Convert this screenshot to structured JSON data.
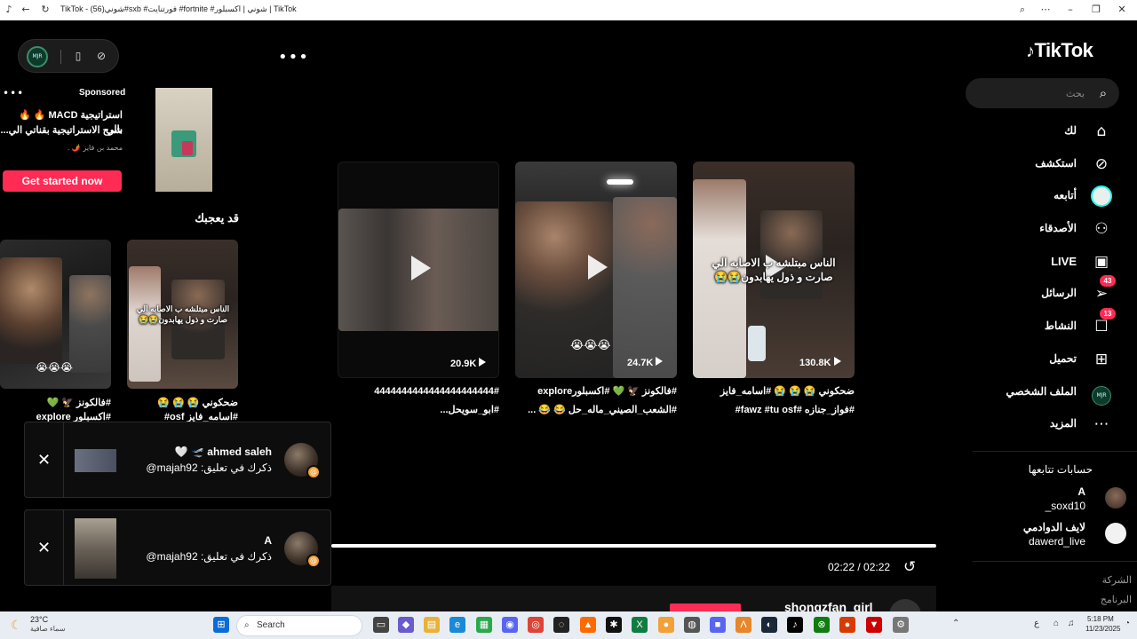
{
  "browser": {
    "title": "TikTok - شوني(56)#sxb #فورتنايت #fortnite #شوني | اكسبلور | TikTok"
  },
  "mini_toolbar": {
    "avatar_text": "MJR"
  },
  "sponsored": {
    "label": "Sponsored",
    "title_line1": "استراتيجية MACD 🔥 🔥 بالي",
    "title_line2": "شرح الاستراتيجية بقناتي الي...",
    "author": "محمد بن فايز 🌶️ .",
    "cta": "Get started now"
  },
  "suggest_head": "قد يعجبك",
  "suggested": [
    {
      "caption1": "#فالكونز 🦅 💚",
      "caption2": "#اكسبلور explore"
    },
    {
      "overlay": "الناس مبتلشه ب الاصابه الي صارت و ذول يهابدون😭😭",
      "caption1": "ضحكوني 😭 😭 😭",
      "caption2": "#اسامه_فايز osf#"
    }
  ],
  "videos": [
    {
      "views": "20.9K",
      "caption1": "4444444444444444444444#",
      "caption2": "#ابو_سويحل..."
    },
    {
      "views": "24.7K",
      "overlay": "😭😭😭",
      "caption1": "#فالكونز 🦅 💚 #اكسبلورexplore",
      "caption2": "#الشعب_الصيني_ماله_حل 😂 😂 ..."
    },
    {
      "views": "130.8K",
      "overlay": "الناس مبتلشه ب الاصابه الي صارت و ذول يهابدون😭😭",
      "caption1": "ضحكوني 😭 😭 😭 #اسامه_فايز",
      "caption2": "#فواز_جنازه #fawz #tu osf#"
    }
  ],
  "notifications": [
    {
      "name": "ahmed saleh 🛫 🤍",
      "text": "ذكرك في تعليق: majah92@"
    },
    {
      "name": "A",
      "text": "ذكرك في تعليق: majah92@"
    }
  ],
  "player": {
    "time": "02:22 / 02:22",
    "progress": 1.0
  },
  "sidebar": {
    "logo": "TikTok",
    "search_placeholder": "بحث",
    "nav": [
      {
        "label": "لك",
        "icon": "home-icon"
      },
      {
        "label": "استكشف",
        "icon": "compass-icon"
      },
      {
        "label": "أتابعه",
        "icon": "following-avatar-icon"
      },
      {
        "label": "الأصدقاء",
        "icon": "friends-icon"
      },
      {
        "label": "LIVE",
        "icon": "live-icon"
      },
      {
        "label": "الرسائل",
        "icon": "messages-icon",
        "badge": "43"
      },
      {
        "label": "النشاط",
        "icon": "activity-icon",
        "badge": "13"
      },
      {
        "label": "تحميل",
        "icon": "upload-icon"
      },
      {
        "label": "الملف الشخصي",
        "icon": "profile-avatar-icon"
      },
      {
        "label": "المزيد",
        "icon": "more-icon"
      }
    ],
    "following_head": "حسابات تتابعها",
    "following": [
      {
        "name": "A",
        "handle": "_soxd10"
      },
      {
        "name": "لايف الدوادمي",
        "handle": "dawerd_live"
      }
    ],
    "footer": [
      "الشركة",
      "البرنامج"
    ]
  },
  "bottom_peek": {
    "user": "shongzfan_girl"
  },
  "taskbar": {
    "weather_temp": "23°C",
    "weather_desc": "سماء صافية",
    "search_label": "Search",
    "time": "5:18 PM",
    "date": "11/23/2025",
    "lang": "ع"
  },
  "colors": {
    "accent": "#fe2c55",
    "bg": "#000000",
    "sidebar_search": "#1f1f1f"
  }
}
